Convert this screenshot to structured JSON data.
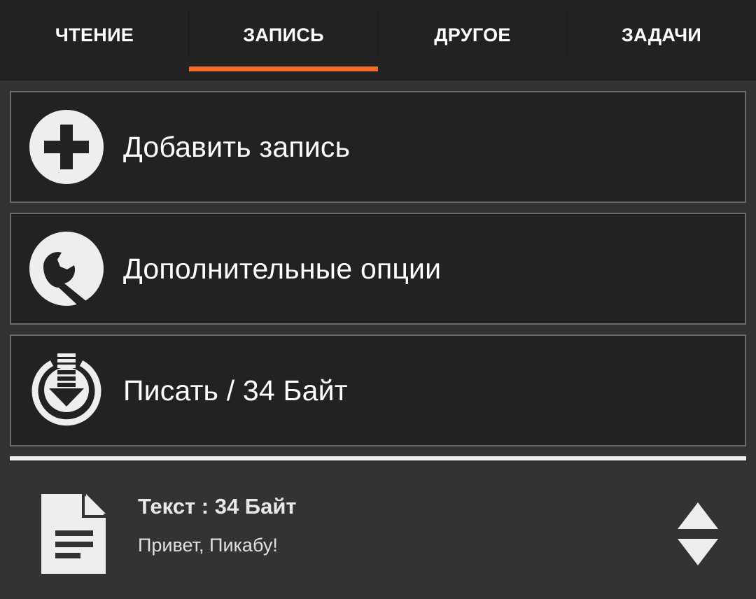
{
  "tabs": [
    {
      "label": "ЧТЕНИЕ"
    },
    {
      "label": "ЗАПИСЬ",
      "active": true
    },
    {
      "label": "ДРУГОЕ"
    },
    {
      "label": "ЗАДАЧИ"
    }
  ],
  "accent_color": "#f26b2a",
  "actions": {
    "add_record": {
      "label": "Добавить запись",
      "icon": "plus-circle-icon"
    },
    "more_options": {
      "label": "Дополнительные опции",
      "icon": "wrench-icon"
    },
    "write": {
      "label": "Писать / 34 Байт",
      "icon": "download-circle-icon"
    }
  },
  "records": [
    {
      "title": "Текст : 34 Байт",
      "content": "Привет, Пикабу!",
      "icon": "document-icon"
    }
  ]
}
